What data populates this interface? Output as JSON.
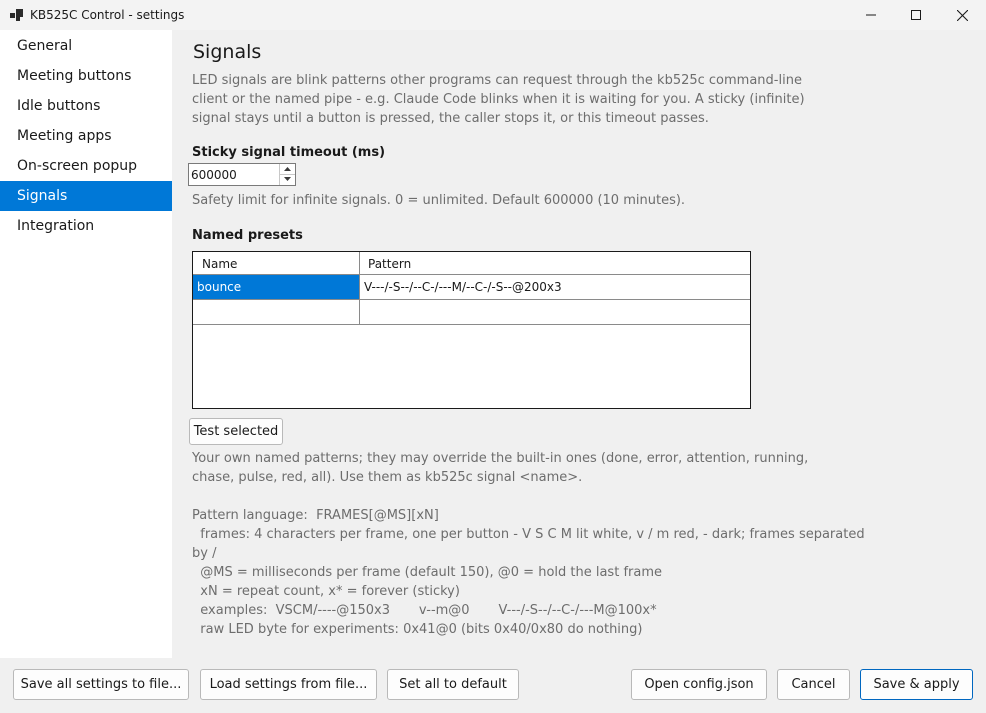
{
  "window": {
    "title": "KB525C Control - settings",
    "minimize_glyph": "minimize-icon",
    "maximize_glyph": "maximize-icon",
    "close_glyph": "close-icon"
  },
  "sidebar": {
    "items": [
      {
        "label": "General"
      },
      {
        "label": "Meeting buttons"
      },
      {
        "label": "Idle buttons"
      },
      {
        "label": "Meeting apps"
      },
      {
        "label": "On-screen popup"
      },
      {
        "label": "Signals",
        "active": true
      },
      {
        "label": "Integration"
      }
    ]
  },
  "signals": {
    "title": "Signals",
    "description": "LED signals are blink patterns other programs can request through the kb525c command-line client or the named pipe - e.g. Claude Code blinks when it is waiting for you. A sticky (infinite) signal stays until a button is pressed, the caller stops it, or this timeout passes.",
    "timeout_label": "Sticky signal timeout (ms)",
    "timeout_value": "600000",
    "timeout_hint": "Safety limit for infinite signals. 0 = unlimited. Default 600000 (10 minutes).",
    "presets_label": "Named presets",
    "columns": {
      "name": "Name",
      "pattern": "Pattern"
    },
    "rows": [
      {
        "name": "bounce",
        "pattern": "V---/-S--/--C-/---M/--C-/-S--@200x3"
      },
      {
        "name": "",
        "pattern": ""
      }
    ],
    "test_button": "Test selected",
    "presets_help": "Your own named patterns; they may override the built-in ones (done, error, attention, running, chase, pulse, red, all). Use them as  kb525c signal <name>.",
    "pattern_help": [
      "Pattern language:  FRAMES[@MS][xN]",
      "  frames: 4 characters per frame, one per button - V S C M lit white, v / m red, - dark; frames separated",
      "by /",
      "  @MS = milliseconds per frame (default 150), @0 = hold the last frame",
      "  xN = repeat count, x* = forever (sticky)",
      "  examples:  VSCM/----@150x3       v--m@0       V---/-S--/--C-/---M@100x*",
      "  raw LED byte for experiments: 0x41@0 (bits 0x40/0x80 do nothing)"
    ]
  },
  "footer": {
    "save_all": "Save all settings to file...",
    "load": "Load settings from file...",
    "set_default": "Set all to default",
    "open_config": "Open config.json",
    "cancel": "Cancel",
    "save_apply": "Save & apply"
  },
  "colors": {
    "accent": "#0078d7",
    "muted_text": "#6d6d6d",
    "content_bg": "#f0f0f0"
  }
}
